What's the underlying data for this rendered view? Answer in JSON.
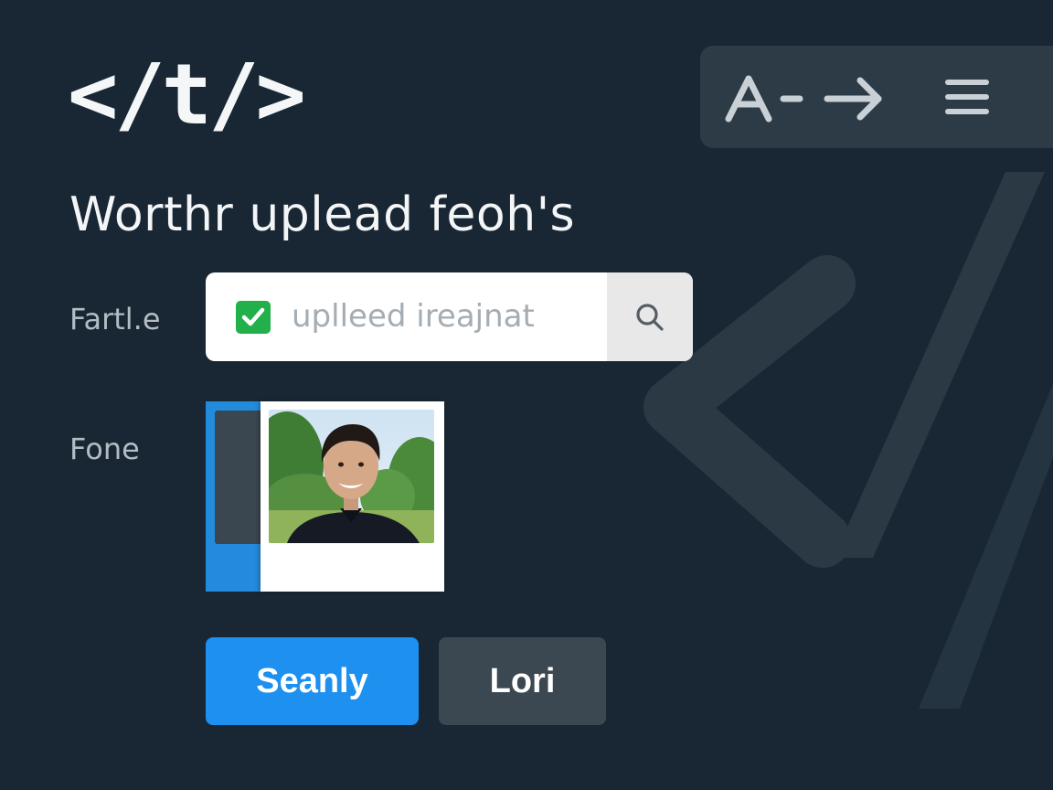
{
  "app": {
    "logo_text": "</t/>"
  },
  "toolbar": {
    "font_size_icon": "font-size-arrow-icon",
    "menu_icon": "hamburger-menu-icon"
  },
  "page": {
    "title": "Worthr uplead feoh's"
  },
  "form": {
    "field_1_label": "Fartl.e",
    "field_2_label": "Fone",
    "search": {
      "placeholder": "uplleed ireajnat",
      "value": "",
      "checkbox_checked": true,
      "search_icon": "search-icon"
    },
    "photo": {
      "alt": "profile photo"
    }
  },
  "actions": {
    "primary_label": "Seanly",
    "secondary_label": "Lori"
  },
  "colors": {
    "background": "#182733",
    "toolbar_bg": "#2c3b46",
    "accent_blue": "#1e90ef",
    "check_green": "#22b04b",
    "secondary_button": "#3c4851"
  }
}
